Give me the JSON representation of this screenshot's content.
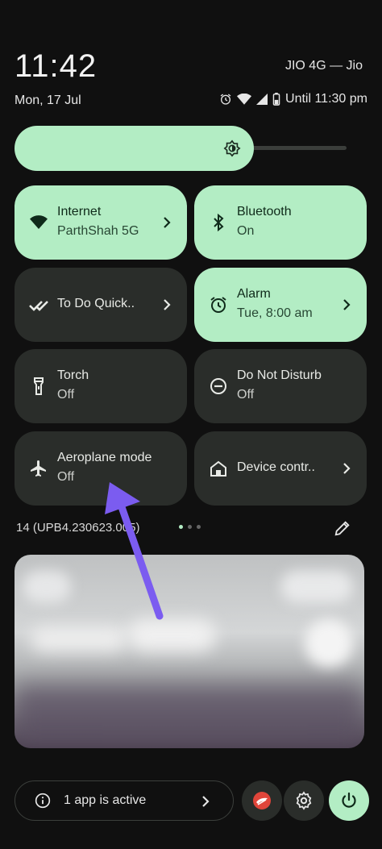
{
  "status_bar": {
    "time": "11:42",
    "date": "Mon, 17 Jul",
    "carrier": "JIO 4G — Jio",
    "battery_text": "Until 11:30 pm",
    "icons": [
      "alarm-icon",
      "wifi-icon",
      "signal-icon",
      "battery-icon"
    ]
  },
  "brightness": {
    "level": 0.72,
    "icon": "brightness-icon"
  },
  "tiles": [
    {
      "title": "Internet",
      "subtitle": "ParthShah 5G",
      "icon": "wifi-icon",
      "active": true,
      "chevron": true
    },
    {
      "title": "Bluetooth",
      "subtitle": "On",
      "icon": "bluetooth-icon",
      "active": true,
      "chevron": false
    },
    {
      "title": "To Do Quick..",
      "subtitle": "",
      "icon": "double-check-icon",
      "active": false,
      "chevron": true
    },
    {
      "title": "Alarm",
      "subtitle": "Tue, 8:00 am",
      "icon": "alarm-icon",
      "active": true,
      "chevron": true
    },
    {
      "title": "Torch",
      "subtitle": "Off",
      "icon": "flashlight-icon",
      "active": false,
      "chevron": false
    },
    {
      "title": "Do Not Disturb",
      "subtitle": "Off",
      "icon": "do-not-disturb-icon",
      "active": false,
      "chevron": false
    },
    {
      "title": "Aeroplane mode",
      "subtitle": "Off",
      "icon": "airplane-icon",
      "active": false,
      "chevron": false
    },
    {
      "title": "Device contr..",
      "subtitle": "",
      "icon": "home-icon",
      "active": false,
      "chevron": true
    }
  ],
  "footer": {
    "build": "14 (UPB4.230623.005)",
    "page_dots": 3,
    "active_page": 0
  },
  "bottom": {
    "active_apps_label": "1 app is active"
  },
  "colors": {
    "accent": "#b3edc4",
    "tile_off": "#2a2d2a",
    "background": "#101010",
    "annotation_arrow": "#7b5cf0"
  }
}
